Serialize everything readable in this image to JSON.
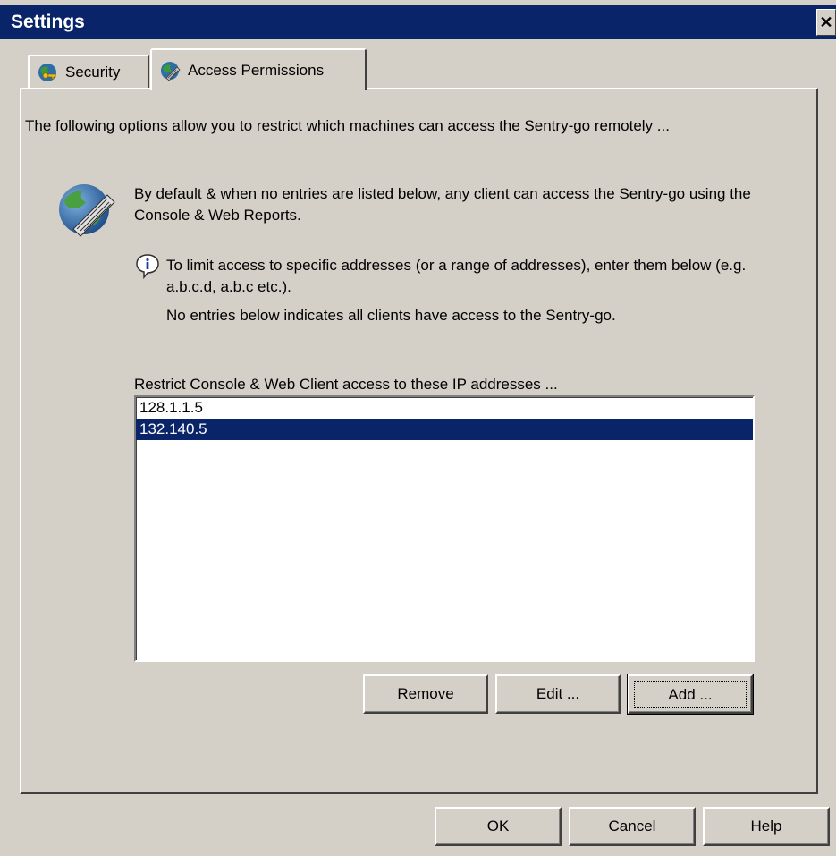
{
  "window": {
    "title": "Settings",
    "close_glyph": "✕"
  },
  "tabs": [
    {
      "label": "Security",
      "icon": "security-key-icon",
      "selected": false
    },
    {
      "label": "Access Permissions",
      "icon": "access-permissions-icon",
      "selected": true
    }
  ],
  "content": {
    "intro": "The following options allow you to restrict which machines can access the Sentry-go remotely ...",
    "default_note": "By default & when no entries are listed below, any client can access the Sentry-go using the Console & Web Reports.",
    "info_limit": "To limit access to specific addresses (or a range of addresses), enter them below (e.g. a.b.c.d, a.b.c etc.).",
    "info_no_entries": "No entries below indicates all clients have access to the Sentry-go.",
    "list_label": "Restrict Console & Web Client access to these IP addresses ..."
  },
  "ip_list": {
    "items": [
      {
        "value": "128.1.1.5",
        "selected": false
      },
      {
        "value": "132.140.5",
        "selected": true
      }
    ]
  },
  "list_buttons": {
    "remove": "Remove",
    "edit": "Edit ...",
    "add": "Add ..."
  },
  "dialog_buttons": {
    "ok": "OK",
    "cancel": "Cancel",
    "help": "Help"
  },
  "colors": {
    "titlebar": "#0a246a",
    "selection": "#0a246a",
    "face": "#d4d0c8"
  }
}
